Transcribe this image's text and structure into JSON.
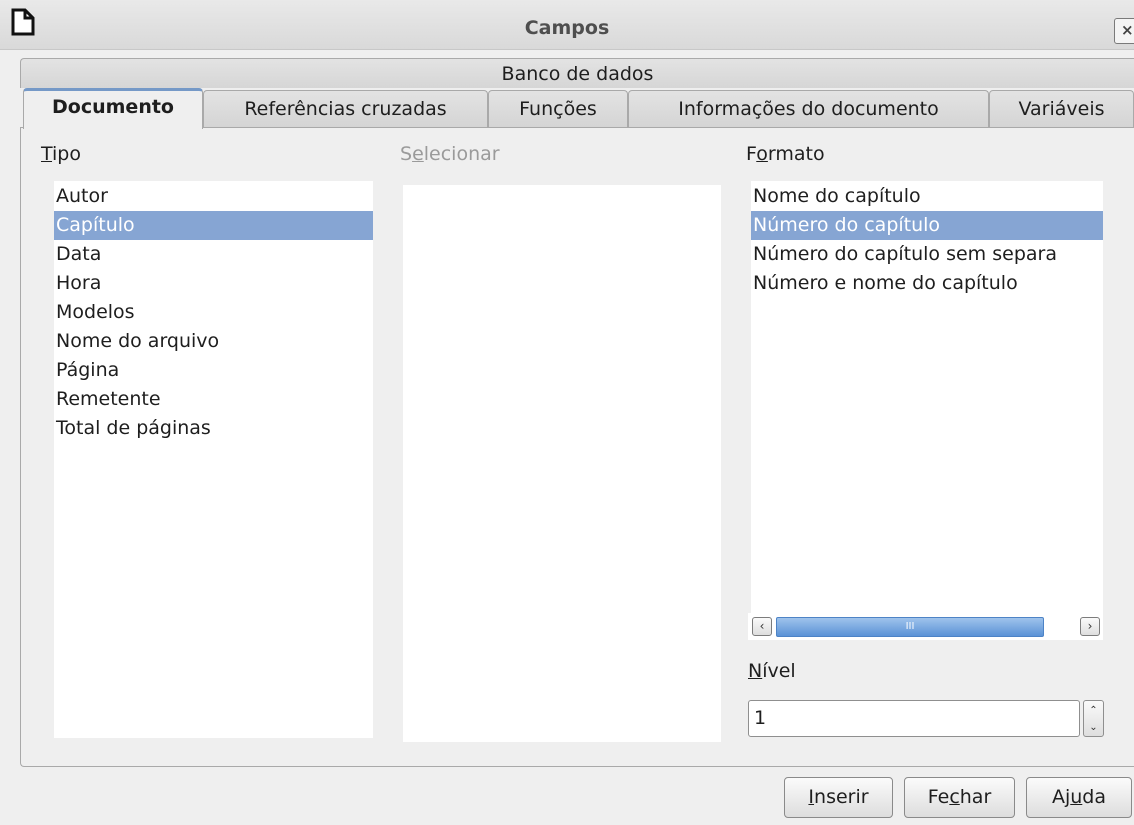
{
  "window": {
    "title": "Campos",
    "close_glyph": "×",
    "icon": "document-icon"
  },
  "tabs": {
    "top_row": [
      "Banco de dados"
    ],
    "bottom_row": [
      "Documento",
      "Referências cruzadas",
      "Funções",
      "Informações do documento",
      "Variáveis"
    ],
    "active": "Documento"
  },
  "labels": {
    "tipo": [
      "",
      "T",
      "ipo"
    ],
    "selecionar": [
      "S",
      "e",
      "lecionar"
    ],
    "formato": [
      "F",
      "o",
      "rmato"
    ],
    "nivel": [
      "",
      "N",
      "ível"
    ]
  },
  "tipo_list": {
    "items": [
      "Autor",
      "Capítulo",
      "Data",
      "Hora",
      "Modelos",
      "Nome do arquivo",
      "Página",
      "Remetente",
      "Total de páginas"
    ],
    "selected": "Capítulo"
  },
  "selecionar_list": {
    "items": []
  },
  "formato_list": {
    "items": [
      "Nome do capítulo",
      "Número do capítulo",
      "Número do capítulo sem separa",
      "Número e nome do capítulo"
    ],
    "selected": "Número do capítulo"
  },
  "scrollbar": {
    "left_glyph": "‹",
    "right_glyph": "›",
    "thumb_glyph": "III"
  },
  "nivel": {
    "value": "1",
    "up_glyph": "⌃",
    "down_glyph": "⌄"
  },
  "buttons": {
    "inserir": [
      "",
      "I",
      "nserir"
    ],
    "fechar": [
      "Fe",
      "c",
      "har"
    ],
    "ajuda": [
      "Aj",
      "u",
      "da"
    ]
  }
}
